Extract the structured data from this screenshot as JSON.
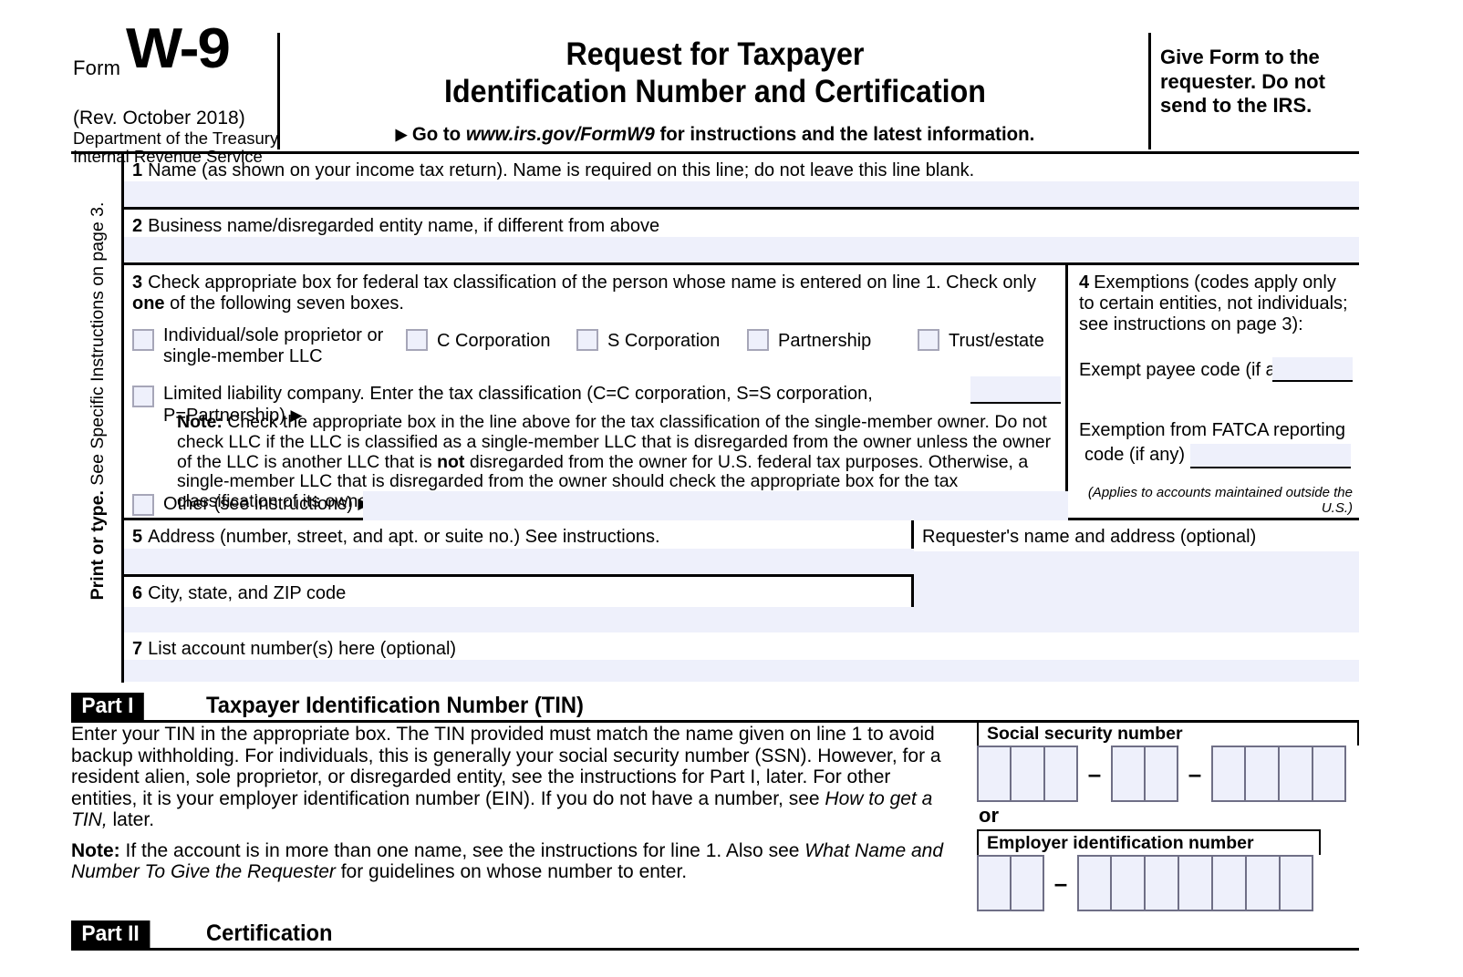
{
  "header": {
    "form_label": "Form",
    "form_number": "W-9",
    "revision": "(Rev. October 2018)",
    "dept_line1": "Department of the Treasury",
    "dept_line2": "Internal Revenue Service",
    "title_line1": "Request for Taxpayer",
    "title_line2": "Identification Number and Certification",
    "goto_prefix": "Go to",
    "goto_url": "www.irs.gov/FormW9",
    "goto_suffix": "for instructions and the latest information.",
    "give_to": "Give Form to the requester. Do not send to the IRS."
  },
  "sidebar": {
    "bold_text": "Print or type.",
    "rest_text": "See Specific Instructions on page 3."
  },
  "lines": {
    "line1": {
      "num": "1",
      "label": "Name (as shown on your income tax return). Name is required on this line; do not leave this line blank.",
      "value": ""
    },
    "line2": {
      "num": "2",
      "label": "Business name/disregarded entity name, if different from above",
      "value": ""
    },
    "line3": {
      "num": "3",
      "label_a": "Check appropriate box for federal tax classification of the person whose name is entered on line 1. Check only ",
      "label_bold": "one",
      "label_b": " of the following seven boxes.",
      "checkboxes": [
        {
          "label": "Individual/sole proprietor or single-member LLC",
          "checked": false
        },
        {
          "label": "C Corporation",
          "checked": false
        },
        {
          "label": "S Corporation",
          "checked": false
        },
        {
          "label": "Partnership",
          "checked": false
        },
        {
          "label": "Trust/estate",
          "checked": false
        }
      ],
      "llc": {
        "label": "Limited liability company. Enter the tax classification (C=C corporation, S=S corporation, P=Partnership)",
        "checked": false,
        "value": ""
      },
      "note_bold": "Note:",
      "note_a": " Check the appropriate box in the line above for the tax classification of the single-member owner.  Do not check LLC if the LLC is classified as a single-member LLC that is disregarded from the owner unless the owner of the LLC is another LLC that is ",
      "note_bold2": "not",
      "note_b": " disregarded from the owner for U.S. federal tax purposes. Otherwise, a single-member LLC that is disregarded from the owner should check the appropriate box for the tax classification of its owner.",
      "other": {
        "label": "Other (see instructions)",
        "checked": false,
        "value": ""
      }
    },
    "line4": {
      "num": "4",
      "label": "Exemptions (codes apply only to certain entities, not individuals; see instructions on page 3):",
      "exempt_payee_label": "Exempt payee code (if any)",
      "exempt_payee_value": "",
      "fatca_label_line1": "Exemption from FATCA reporting",
      "fatca_label_line2": "code (if any)",
      "fatca_value": "",
      "applies_note": "(Applies to accounts maintained outside the U.S.)"
    },
    "line5": {
      "num": "5",
      "label": "Address (number, street, and apt. or suite no.) See instructions.",
      "value": ""
    },
    "line6": {
      "num": "6",
      "label": "City, state, and ZIP code",
      "value": ""
    },
    "line7": {
      "num": "7",
      "label": "List account number(s) here (optional)",
      "value": ""
    },
    "requester": {
      "label": "Requester's name and address (optional)",
      "value": ""
    }
  },
  "part1": {
    "tag": "Part I",
    "title": "Taxpayer Identification Number (TIN)",
    "para1_a": "Enter your TIN in the appropriate box. The TIN provided must match the name given on line 1 to avoid backup withholding. For individuals, this is generally your social security number (SSN). However, for a resident alien, sole proprietor, or disregarded entity, see the instructions for Part I, later. For other entities, it is your employer identification number (EIN). If you do not have a number, see ",
    "para1_italic": "How to get a TIN,",
    "para1_b": " later.",
    "note_bold": "Note:",
    "note_a": " If the account is in more than one name, see the instructions for line 1. Also see ",
    "note_italic": "What Name and Number To Give the Requester",
    "note_b": " for guidelines on whose number to enter.",
    "ssn_label": "Social security number",
    "ssn_groups": [
      3,
      2,
      4
    ],
    "ssn_value": "",
    "or_label": "or",
    "ein_label": "Employer identification number",
    "ein_groups": [
      2,
      7
    ],
    "ein_value": ""
  },
  "part2": {
    "tag": "Part II",
    "title": "Certification"
  },
  "colors": {
    "field_fill": "#eef0fb",
    "field_border": "#6f6f86",
    "checkbox_border": "#a6a6b8",
    "rule": "#000000"
  }
}
